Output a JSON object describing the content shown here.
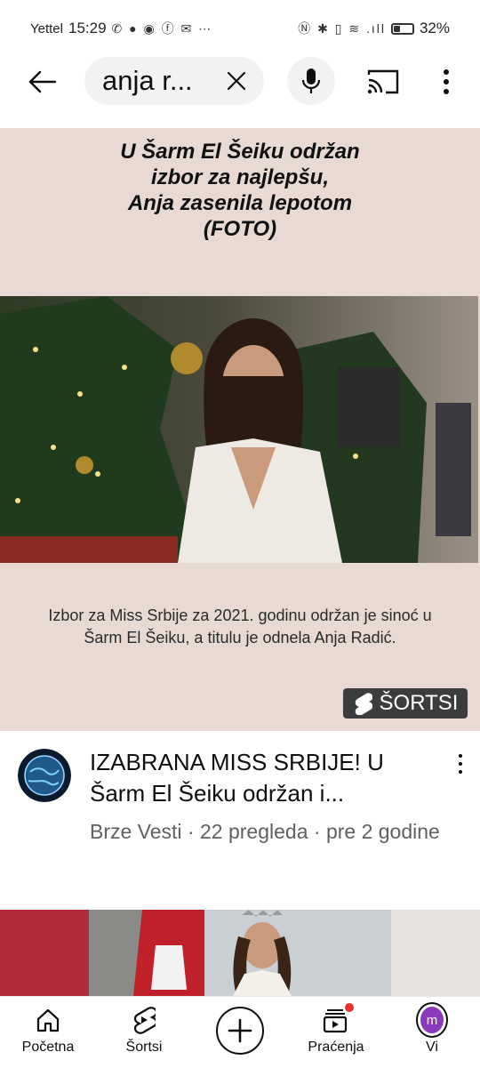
{
  "status": {
    "carrier": "Yettel",
    "time": "15:29",
    "battery": "32%"
  },
  "search": {
    "query": "anja r..."
  },
  "video": {
    "title_lines": [
      "U Šarm El Šeiku održan",
      "izbor za najlepšu,",
      "Anja zasenila lepotom",
      "(FOTO)"
    ],
    "caption": "Izbor za Miss Srbije za 2021. godinu održan je sinoć u Šarm El Šeiku, a titulu je odnela Anja Radić.",
    "badge": "ŠORTSI"
  },
  "meta": {
    "title": "IZABRANA MISS SRBIJE! U Šarm El Šeiku održan i...",
    "channel": "Brze Vesti",
    "views": "22 pregleda",
    "age": "pre 2 godine"
  },
  "nav": {
    "home": "Početna",
    "shorts": "Šortsi",
    "subscriptions": "Praćenja",
    "you": "Vi",
    "avatar_letter": "m"
  },
  "colors": {
    "accent": "#e5332a",
    "avatar": "#8a3bbd",
    "video_bg": "#e8d9d3"
  }
}
